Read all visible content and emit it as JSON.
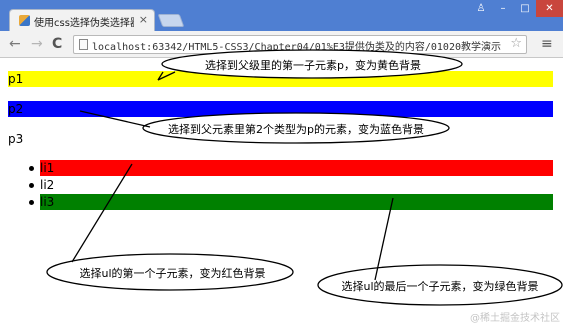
{
  "browser": {
    "tab_title": "使用css选择伪类选择器",
    "tab_close": "×",
    "window_buttons": {
      "user": "♙",
      "minimize": "–",
      "maximize": "□",
      "close": "✕"
    },
    "nav": {
      "back": "←",
      "forward": "→",
      "reload": "C"
    },
    "url": "localhost:63342/HTML5-CSS3/Chapter04/01%E3提供伪类及的内容/01020教学演示.html",
    "star": "☆",
    "menu": "≡"
  },
  "page": {
    "p1": "p1",
    "p2": "p2",
    "p3": "p3",
    "list": [
      "li1",
      "li2",
      "li3"
    ]
  },
  "annotations": {
    "first_child_p": "选择到父级里的第一子元素p，变为黄色背景",
    "nth_of_type_p": "选择到父元素里第2个类型为p的元素，变为蓝色背景",
    "first_child_ul": "选择ul的第一个子元素，变为红色背景",
    "last_child_ul": "选择ul的最后一个子元素，变为绿色背景"
  },
  "colors": {
    "yellow": "#ffff00",
    "blue": "#0000ff",
    "red": "#ff0000",
    "green": "#008000"
  },
  "watermark": "@稀土掘金技术社区"
}
